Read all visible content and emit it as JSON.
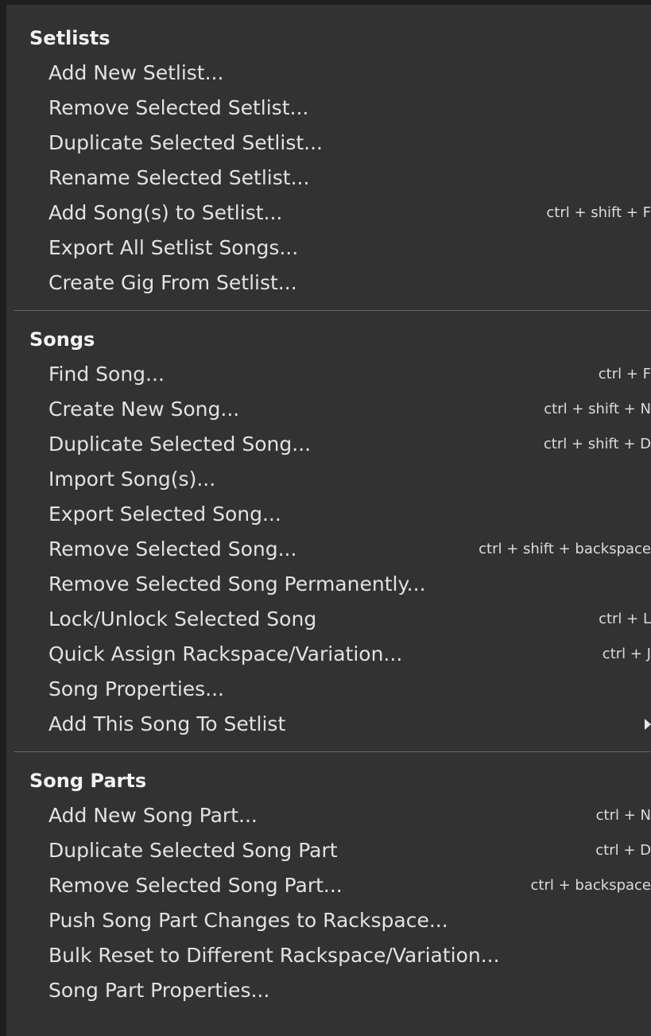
{
  "menu": {
    "sections": [
      {
        "title": "Setlists",
        "items": [
          {
            "label": "Add New Setlist...",
            "shortcut": ""
          },
          {
            "label": "Remove Selected Setlist...",
            "shortcut": ""
          },
          {
            "label": "Duplicate Selected Setlist...",
            "shortcut": ""
          },
          {
            "label": "Rename Selected Setlist...",
            "shortcut": ""
          },
          {
            "label": "Add Song(s) to Setlist...",
            "shortcut": "ctrl + shift + F"
          },
          {
            "label": "Export All Setlist Songs...",
            "shortcut": ""
          },
          {
            "label": "Create Gig From Setlist...",
            "shortcut": ""
          }
        ]
      },
      {
        "title": "Songs",
        "items": [
          {
            "label": "Find Song...",
            "shortcut": "ctrl + F"
          },
          {
            "label": "Create New Song...",
            "shortcut": "ctrl + shift + N"
          },
          {
            "label": "Duplicate Selected Song...",
            "shortcut": "ctrl + shift + D"
          },
          {
            "label": "Import Song(s)...",
            "shortcut": ""
          },
          {
            "label": "Export Selected Song...",
            "shortcut": ""
          },
          {
            "label": "Remove Selected Song...",
            "shortcut": "ctrl + shift + backspace"
          },
          {
            "label": "Remove Selected Song Permanently...",
            "shortcut": ""
          },
          {
            "label": "Lock/Unlock Selected Song",
            "shortcut": "ctrl + L"
          },
          {
            "label": "Quick Assign Rackspace/Variation...",
            "shortcut": "ctrl + J"
          },
          {
            "label": "Song Properties...",
            "shortcut": ""
          },
          {
            "label": "Add This Song To Setlist",
            "shortcut": "",
            "submenu": true
          }
        ]
      },
      {
        "title": "Song Parts",
        "items": [
          {
            "label": "Add New Song Part...",
            "shortcut": "ctrl + N"
          },
          {
            "label": "Duplicate Selected Song Part",
            "shortcut": "ctrl + D"
          },
          {
            "label": "Remove Selected Song Part...",
            "shortcut": "ctrl + backspace"
          },
          {
            "label": "Push Song Part Changes to Rackspace...",
            "shortcut": ""
          },
          {
            "label": "Bulk Reset to Different Rackspace/Variation...",
            "shortcut": ""
          },
          {
            "label": "Song Part Properties...",
            "shortcut": ""
          }
        ]
      }
    ]
  }
}
